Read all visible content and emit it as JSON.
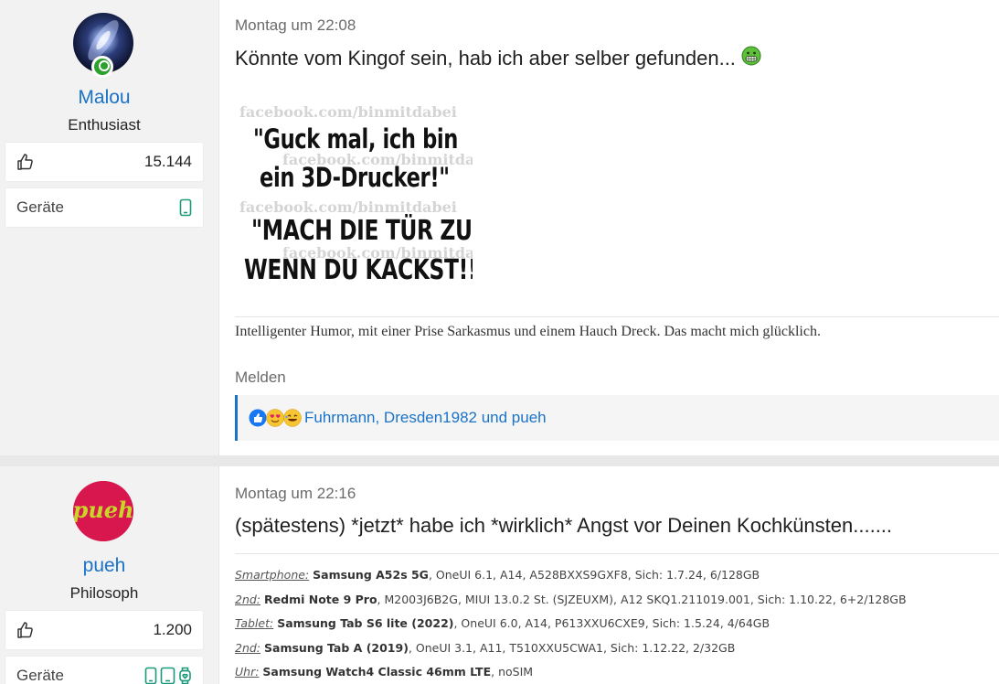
{
  "posts": [
    {
      "author": {
        "name": "Malou",
        "rank": "Enthusiast",
        "likes": "15.144",
        "devices_label": "Geräte"
      },
      "date": "Montag um 22:08",
      "text": "Könnte vom Kingof sein, hab ich aber selber gefunden...",
      "meme": {
        "watermark": "facebook.com/binmitdabei",
        "line1": "\"Guck mal, ich bin",
        "line2": "ein 3D-Drucker!\"",
        "line3": "\"MACH DIE TÜR ZU,",
        "line4": "WENN DU KACKST!!\""
      },
      "signature": "Intelligenter Humor, mit einer Prise Sarkasmus und einem Hauch Dreck. Das macht mich glücklich.",
      "report_label": "Melden",
      "reactions": {
        "names": "Fuhrmann, Dresden1982 und pueh",
        "icons": [
          "like-icon",
          "love-icon",
          "laugh-icon"
        ]
      }
    },
    {
      "author": {
        "name": "pueh",
        "avatar_text": "pueh",
        "rank": "Philosoph",
        "likes": "1.200",
        "devices_label": "Geräte"
      },
      "date": "Montag um 22:16",
      "text": "(spätestens) *jetzt* habe ich *wirklich* Angst vor Deinen Kochkünsten.......",
      "signature_rows": [
        {
          "key": "Smartphone:",
          "device": "Samsung A52s 5G",
          "rest": ", OneUI 6.1, A14, A528BXXS9GXF8, Sich: 1.7.24, 6/128GB"
        },
        {
          "key": "2nd:",
          "device": "Redmi Note 9 Pro",
          "rest": ", M2003J6B2G, MIUI 13.0.2 St. (SJZEUXM), A12 SKQ1.211019.001, Sich: 1.10.22, 6+2/128GB"
        },
        {
          "key": "Tablet:",
          "device": "Samsung Tab S6 lite (2022)",
          "rest": ", OneUI 6.0, A14, P613XXU6CXE9, Sich: 1.5.24, 4/64GB"
        },
        {
          "key": "2nd:",
          "device": "Samsung Tab A (2019)",
          "rest": ", OneUI 3.1, A11, T510XXU5CWA1, Sich: 1.12.22, 2/32GB"
        },
        {
          "key": "Uhr:",
          "device": "Samsung Watch4 Classic 46mm LTE",
          "rest": ", noSIM"
        }
      ]
    }
  ],
  "colors": {
    "accent": "#1a73c8",
    "online": "#2ea02e",
    "device_icon": "#1a9a7a",
    "sidebar_bg": "#f2f2f2"
  }
}
